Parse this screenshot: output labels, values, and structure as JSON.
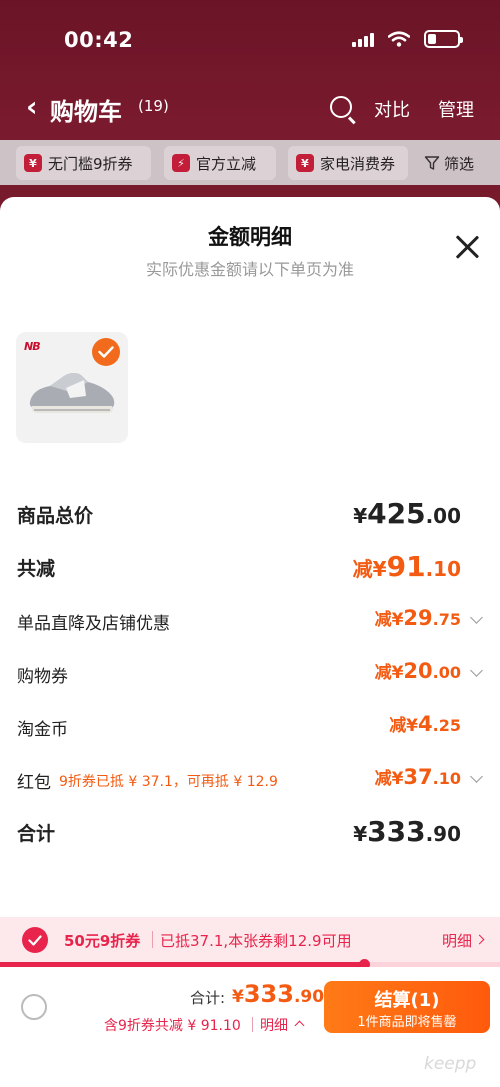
{
  "status_bar": {
    "time": "00:42"
  },
  "nav": {
    "back_icon": "chevron-left-icon",
    "title": "购物车",
    "count": "(19)",
    "compare_label": "对比",
    "manage_label": "管理"
  },
  "filters": [
    {
      "icon": "coupon-icon",
      "label": "无门槛9折券"
    },
    {
      "icon": "lightning-icon",
      "label": "官方立减"
    },
    {
      "icon": "coupon-icon",
      "label": "家电消费券"
    },
    {
      "icon": "filter-icon",
      "label": "筛选"
    }
  ],
  "sheet": {
    "title": "金额明细",
    "subtitle": "实际优惠金额请以下单页为准",
    "product": {
      "brand_logo": "NB",
      "selected": true
    }
  },
  "breakdown": {
    "total_price": {
      "label": "商品总价",
      "yen": "¥",
      "int": "425",
      "dec": ".00"
    },
    "total_discount": {
      "label": "共减",
      "prefix": "减¥",
      "int": "91",
      "dec": ".10"
    },
    "direct_discount": {
      "label": "单品直降及店铺优惠",
      "prefix": "减¥",
      "int": "29",
      "dec": ".75"
    },
    "shopping_coupon": {
      "label": "购物券",
      "prefix": "减¥",
      "int": "20",
      "dec": ".00"
    },
    "taojinbi": {
      "label": "淘金币",
      "prefix": "减¥",
      "int": "4",
      "dec": ".25"
    },
    "red_packet": {
      "label": "红包",
      "note": "9折券已抵 ¥ 37.1，可再抵 ¥ 12.9",
      "prefix": "减¥",
      "int": "37",
      "dec": ".10"
    },
    "sum": {
      "label": "合计",
      "yen": "¥",
      "int": "333",
      "dec": ".90"
    }
  },
  "coupon_bar": {
    "name": "50元9折券",
    "desc": "已抵37.1,本张券剩12.9可用",
    "detail_label": "明细",
    "progress": 0.727
  },
  "footer": {
    "total_label": "合计:",
    "total_yen": "¥",
    "total_int": "333",
    "total_dec": ".90",
    "saving_text": "含9折券共减 ¥ 91.10",
    "saving_detail": "明细",
    "checkout_label": "结算(1)",
    "checkout_sub": "1件商品即将售罄"
  },
  "watermark": "keepp",
  "colors": {
    "accent_orange": "#f35b13",
    "accent_red": "#e8244c",
    "header_bg": "#6b1427",
    "checkout": "#ff6a12"
  }
}
